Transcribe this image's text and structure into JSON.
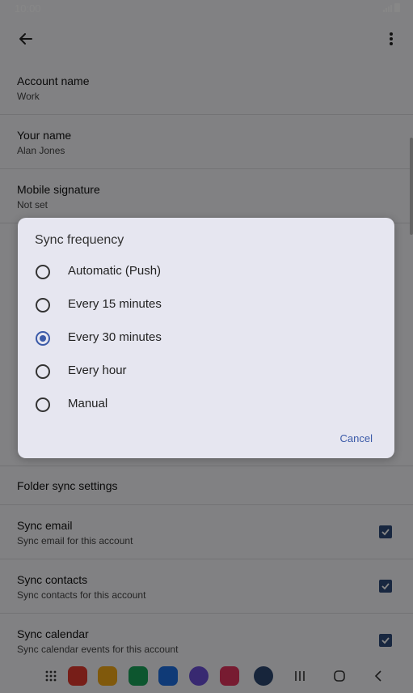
{
  "status_bar": {
    "time": "10:00"
  },
  "settings": {
    "account_name": {
      "title": "Account name",
      "value": "Work"
    },
    "your_name": {
      "title": "Your name",
      "value": "Alan Jones"
    },
    "mobile_signature": {
      "title": "Mobile signature",
      "value": "Not set"
    },
    "folder_sync": {
      "title": "Folder sync settings"
    },
    "sync_email": {
      "title": "Sync email",
      "subtitle": "Sync email for this account",
      "checked": true
    },
    "sync_contacts": {
      "title": "Sync contacts",
      "subtitle": "Sync contacts for this account",
      "checked": true
    },
    "sync_calendar": {
      "title": "Sync calendar",
      "subtitle": "Sync calendar events for this account",
      "checked": true
    }
  },
  "dialog": {
    "title": "Sync frequency",
    "options": [
      {
        "label": "Automatic (Push)",
        "selected": false
      },
      {
        "label": "Every 15 minutes",
        "selected": false
      },
      {
        "label": "Every 30 minutes",
        "selected": true
      },
      {
        "label": "Every hour",
        "selected": false
      },
      {
        "label": "Manual",
        "selected": false
      }
    ],
    "cancel_label": "Cancel"
  },
  "colors": {
    "accent": "#3b5aa8",
    "checkbox": "#2f4a7a"
  },
  "nav_apps": [
    "apps-grid-icon",
    "flipboard-icon",
    "files-icon",
    "phone-icon",
    "messages-icon",
    "internet-icon",
    "camera-icon",
    "settings-icon"
  ]
}
